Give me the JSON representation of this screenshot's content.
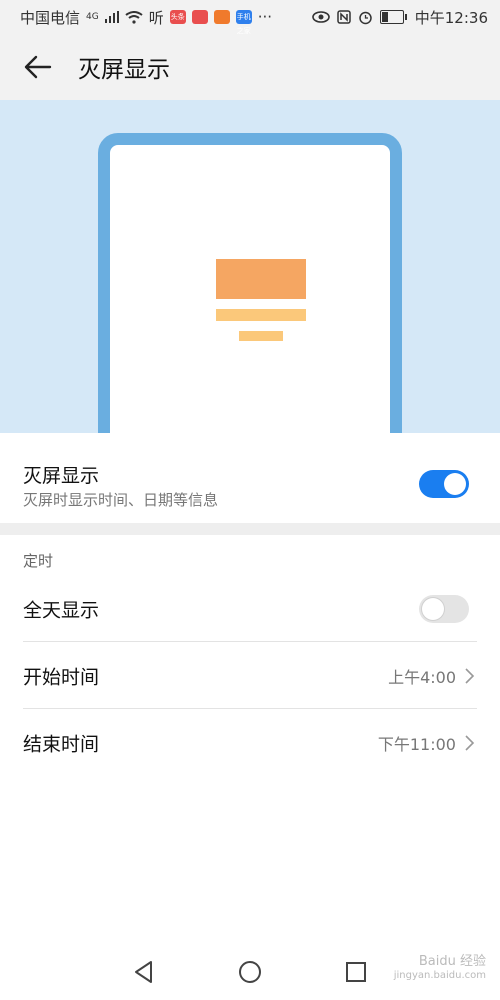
{
  "status_bar": {
    "carrier": "中国电信",
    "network": "4G",
    "audio_app": "听",
    "mini_app_badges": [
      "头条",
      "",
      "",
      "手机之家"
    ],
    "more": "···",
    "time": "中午12:36"
  },
  "header": {
    "title": "灭屏显示",
    "back_icon": "arrow-left-icon"
  },
  "colors": {
    "accent": "#1a7ef0",
    "hero_bg": "#d5e8f7",
    "phone_frame": "#6aaee0",
    "bar_primary": "#f5a662",
    "bar_secondary": "#fbc87a"
  },
  "aod": {
    "title": "灭屏显示",
    "subtitle": "灭屏时显示时间、日期等信息",
    "enabled": true
  },
  "timer_section": {
    "label": "定时",
    "all_day": {
      "label": "全天显示",
      "enabled": false
    },
    "start": {
      "label": "开始时间",
      "value": "上午4:00"
    },
    "end": {
      "label": "结束时间",
      "value": "下午11:00"
    }
  },
  "nav": {
    "back": "triangle-back-icon",
    "home": "circle-home-icon",
    "recents": "square-recents-icon"
  },
  "watermark": {
    "brand": "Baidu 经验",
    "url": "jingyan.baidu.com"
  }
}
